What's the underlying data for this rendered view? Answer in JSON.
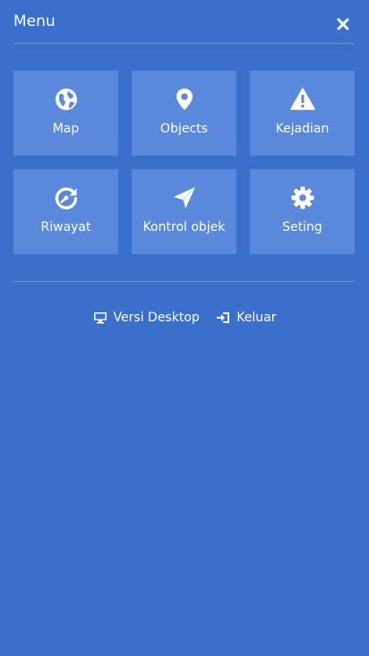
{
  "menu": {
    "title": "Menu",
    "close_icon": "close-icon"
  },
  "tiles": [
    {
      "label": "Map",
      "icon": "globe-icon"
    },
    {
      "label": "Objects",
      "icon": "map-marker-icon"
    },
    {
      "label": "Kejadian",
      "icon": "warning-icon"
    },
    {
      "label": "Riwayat",
      "icon": "history-icon"
    },
    {
      "label": "Kontrol objek",
      "icon": "paper-plane-icon"
    },
    {
      "label": "Seting",
      "icon": "gear-icon"
    }
  ],
  "footer": {
    "desktop_label": "Versi Desktop",
    "desktop_icon": "desktop-icon",
    "logout_label": "Keluar",
    "logout_icon": "logout-icon"
  },
  "colors": {
    "background": "#3a6fcb",
    "tile": "#5a88da",
    "text": "#ffffff"
  }
}
